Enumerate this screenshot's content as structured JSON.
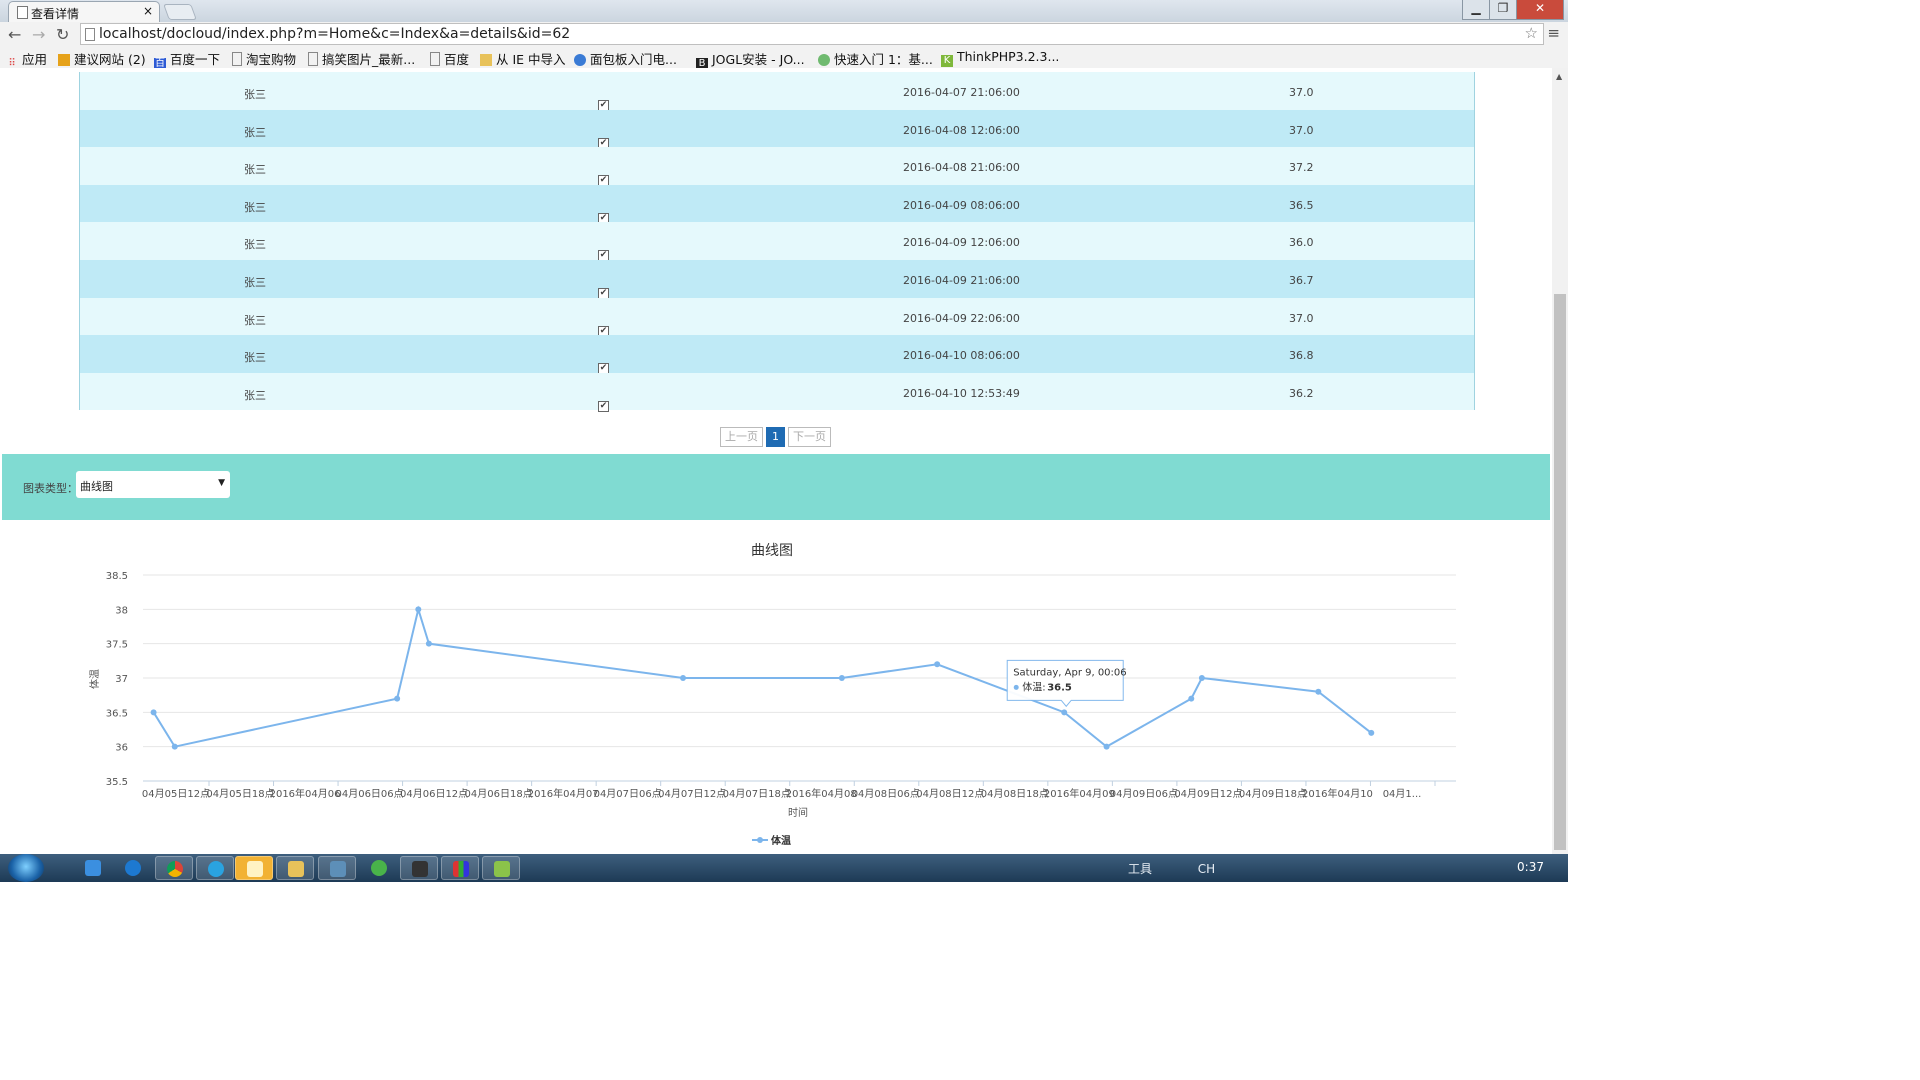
{
  "browser": {
    "tab_title": "查看详情",
    "tab_close": "×",
    "url": "localhost/docloud/index.php?m=Home&c=Index&a=details&id=62",
    "bookmarks": [
      "应用",
      "建议网站 (2)",
      "百度一下",
      "淘宝购物",
      "搞笑图片_最新...",
      "百度",
      "从 IE 中导入",
      "面包板入门电...",
      "JOGL安装 - JO...",
      "快速入门 1：基...",
      "ThinkPHP3.2.3..."
    ]
  },
  "table": {
    "rows": [
      {
        "name": "张三",
        "checked": "✔",
        "time": "2016-04-07 21:06:00",
        "temp": "37.0"
      },
      {
        "name": "张三",
        "checked": "✔",
        "time": "2016-04-08 12:06:00",
        "temp": "37.0"
      },
      {
        "name": "张三",
        "checked": "✔",
        "time": "2016-04-08 21:06:00",
        "temp": "37.2"
      },
      {
        "name": "张三",
        "checked": "✔",
        "time": "2016-04-09 08:06:00",
        "temp": "36.5"
      },
      {
        "name": "张三",
        "checked": "✔",
        "time": "2016-04-09 12:06:00",
        "temp": "36.0"
      },
      {
        "name": "张三",
        "checked": "✔",
        "time": "2016-04-09 21:06:00",
        "temp": "36.7"
      },
      {
        "name": "张三",
        "checked": "✔",
        "time": "2016-04-09 22:06:00",
        "temp": "37.0"
      },
      {
        "name": "张三",
        "checked": "✔",
        "time": "2016-04-10 08:06:00",
        "temp": "36.8"
      },
      {
        "name": "张三",
        "checked": "✔",
        "time": "2016-04-10 12:53:49",
        "temp": "36.2"
      }
    ]
  },
  "pager": {
    "prev": "上一页",
    "current": "1",
    "next": "下一页"
  },
  "controls": {
    "chart_type_label": "图表类型：",
    "chart_type_value": "曲线图"
  },
  "chart_data": {
    "type": "line",
    "title": "曲线图",
    "xlabel": "时间",
    "ylabel": "体温",
    "ylim": [
      35.5,
      38.5
    ],
    "yticks": [
      "38.5",
      "38",
      "37.5",
      "37",
      "36.5",
      "36",
      "35.5"
    ],
    "xticks": [
      "04月05日12点",
      "04月05日18点",
      "2016年04月06",
      "04月06日06点",
      "04月06日12点",
      "04月06日18点",
      "2016年04月07",
      "04月07日06点",
      "04月07日12点",
      "04月07日18点",
      "2016年04月08",
      "04月08日06点",
      "04月08日12点",
      "04月08日18点",
      "2016年04月09",
      "04月09日06点",
      "04月09日12点",
      "04月09日18点",
      "2016年04月10",
      "04月1..."
    ],
    "series": [
      {
        "name": "体温",
        "color": "#7cb5ec",
        "x": [
          "2016-04-05 10:06",
          "2016-04-05 12:06",
          "2016-04-06 09:06",
          "2016-04-06 11:06",
          "2016-04-06 12:06",
          "2016-04-07 12:06",
          "2016-04-08 03:06",
          "2016-04-08 12:06",
          "2016-04-09 00:06",
          "2016-04-09 04:06",
          "2016-04-09 12:06",
          "2016-04-09 13:06",
          "2016-04-10 00:06",
          "2016-04-10 05:06"
        ],
        "values": [
          36.5,
          36.0,
          36.7,
          38.0,
          37.5,
          37.0,
          37.0,
          37.2,
          36.5,
          36.0,
          36.7,
          37.0,
          36.8,
          36.2
        ]
      }
    ],
    "legend": "bottom-center",
    "tooltip": {
      "date": "Saturday, Apr 9, 00:06",
      "label": "体温: ",
      "value": "36.5",
      "point_index": 8
    }
  },
  "taskbar": {
    "tray_text": "工具",
    "ime": "CH",
    "clock": "0:37"
  }
}
